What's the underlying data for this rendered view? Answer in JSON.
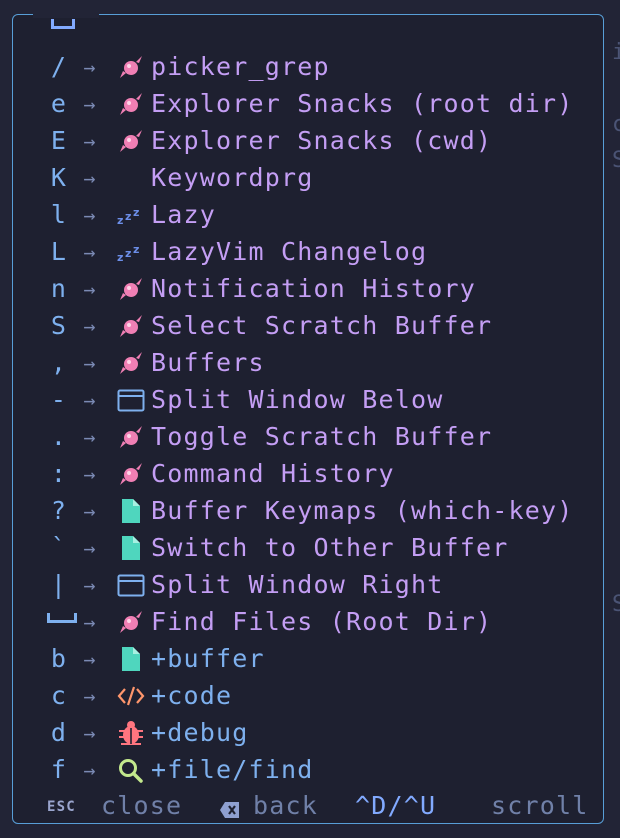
{
  "colors": {
    "background": "#222436",
    "panel": "#1e2030",
    "border": "#589ed7",
    "key": "#7eb0ee",
    "description": "#c49ef4",
    "group": "#7eb0ee",
    "snacks_icon": "#f07fb4",
    "lazy_icon": "#6c8ee8",
    "file_icon": "#4fd6be",
    "window_icon": "#7eb0ee",
    "code_icon": "#ff966c",
    "debug_icon": "#ff757f",
    "find_icon": "#c3e88d"
  },
  "arrow_glyph": "→",
  "entries": [
    {
      "key": "/",
      "icon": "candy-icon",
      "label": "picker_grep",
      "kind": "desc"
    },
    {
      "key": "e",
      "icon": "candy-icon",
      "label": "Explorer Snacks (root dir)",
      "kind": "desc"
    },
    {
      "key": "E",
      "icon": "candy-icon",
      "label": "Explorer Snacks (cwd)",
      "kind": "desc"
    },
    {
      "key": "K",
      "icon": "",
      "label": "Keywordprg",
      "kind": "desc"
    },
    {
      "key": "l",
      "icon": "sleep-icon",
      "label": "Lazy",
      "kind": "desc"
    },
    {
      "key": "L",
      "icon": "sleep-icon",
      "label": "LazyVim Changelog",
      "kind": "desc"
    },
    {
      "key": "n",
      "icon": "candy-icon",
      "label": "Notification History",
      "kind": "desc"
    },
    {
      "key": "S",
      "icon": "candy-icon",
      "label": "Select Scratch Buffer",
      "kind": "desc"
    },
    {
      "key": ",",
      "icon": "candy-icon",
      "label": "Buffers",
      "kind": "desc"
    },
    {
      "key": "-",
      "icon": "window-icon",
      "label": "Split Window Below",
      "kind": "desc"
    },
    {
      "key": ".",
      "icon": "candy-icon",
      "label": "Toggle Scratch Buffer",
      "kind": "desc"
    },
    {
      "key": ":",
      "icon": "candy-icon",
      "label": "Command History",
      "kind": "desc"
    },
    {
      "key": "?",
      "icon": "file-icon",
      "label": "Buffer Keymaps (which-key)",
      "kind": "desc"
    },
    {
      "key": "`",
      "icon": "file-icon",
      "label": "Switch to Other Buffer",
      "kind": "desc"
    },
    {
      "key": "|",
      "icon": "window-icon",
      "label": "Split Window Right",
      "kind": "desc"
    },
    {
      "key": "␣",
      "icon": "candy-icon",
      "label": "Find Files (Root Dir)",
      "kind": "desc"
    },
    {
      "key": "b",
      "icon": "file-icon",
      "label": "+buffer",
      "kind": "group"
    },
    {
      "key": "c",
      "icon": "code-icon",
      "label": "+code",
      "kind": "group"
    },
    {
      "key": "d",
      "icon": "bug-icon",
      "label": "+debug",
      "kind": "group"
    },
    {
      "key": "f",
      "icon": "search-icon",
      "label": "+file/find",
      "kind": "group"
    }
  ],
  "footer": {
    "esc_label": "ESC",
    "close_label": "close",
    "back_label": "back",
    "scroll_keys": "^D/^U",
    "scroll_label": "scroll"
  }
}
